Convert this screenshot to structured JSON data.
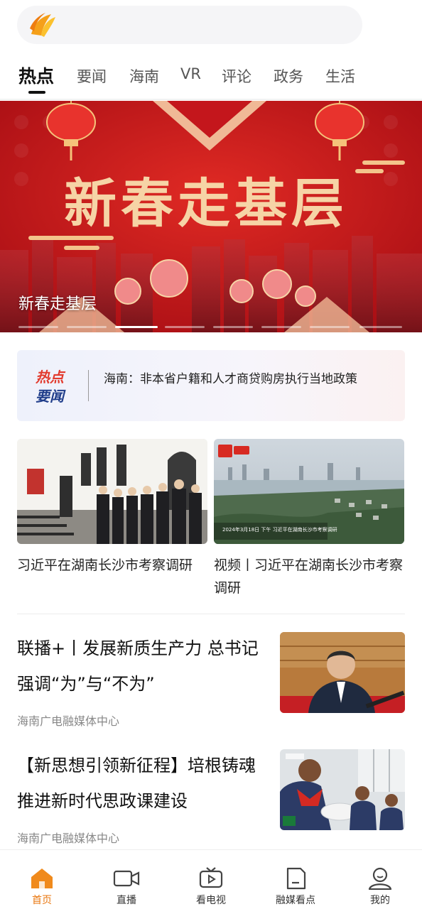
{
  "search": {
    "logo_icon": "hainan-logo-icon"
  },
  "tabs": [
    {
      "label": "热点",
      "active": true
    },
    {
      "label": "要闻"
    },
    {
      "label": "海南"
    },
    {
      "label": "VR"
    },
    {
      "label": "评论"
    },
    {
      "label": "政务"
    },
    {
      "label": "生活"
    }
  ],
  "banner": {
    "artwork_text": "新春走基层",
    "caption": "新春走基层",
    "slide_count": 8,
    "active_slide": 3
  },
  "hot_news": {
    "label_line1": "热点",
    "label_line2": "要闻",
    "headline": "海南：非本省户籍和人才商贷购房执行当地政策"
  },
  "cards": [
    {
      "title": "习近平在湖南长沙市考察调研"
    },
    {
      "title": "视频丨习近平在湖南长沙市考察调研",
      "image_overlay": "2024年3月18日 下午 习近平在湖南长沙市考察调研"
    }
  ],
  "articles": [
    {
      "title": "联播+丨发展新质生产力 总书记强调“为”与“不为”",
      "source": "海南广电融媒体中心"
    },
    {
      "title": "【新思想引领新征程】培根铸魂 推进新时代思政课建设",
      "source": "海南广电融媒体中心"
    }
  ],
  "bottom_nav": [
    {
      "label": "首页",
      "icon": "home-icon",
      "active": true
    },
    {
      "label": "直播",
      "icon": "live-camera-icon"
    },
    {
      "label": "看电视",
      "icon": "tv-icon"
    },
    {
      "label": "融媒看点",
      "icon": "document-icon"
    },
    {
      "label": "我的",
      "icon": "profile-icon"
    }
  ],
  "colors": {
    "accent": "#e9760e",
    "banner_red": "#c4161c",
    "hot_red": "#e23b2e",
    "hot_blue": "#1f3d8a"
  }
}
